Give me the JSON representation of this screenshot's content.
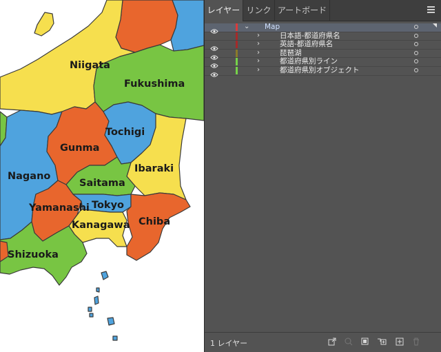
{
  "map": {
    "colors": {
      "yellow": "#f6df4e",
      "orange": "#e8662d",
      "green": "#78c543",
      "blue": "#4fa3de",
      "outline": "#3a3a3a"
    },
    "labels": {
      "niigata": "Niigata",
      "fukushima": "Fukushima",
      "tochigi": "Tochigi",
      "gunma": "Gunma",
      "ibaraki": "Ibaraki",
      "nagano": "Nagano",
      "saitama": "Saitama",
      "yamanashi": "Yamanashi",
      "tokyo": "Tokyo",
      "kanagawa": "Kanagawa",
      "chiba": "Chiba",
      "shizuoka": "Shizuoka"
    }
  },
  "panel": {
    "tabs": [
      "レイヤー",
      "リンク",
      "アートボード"
    ],
    "active_tab": "レイヤー",
    "menu_icon": "hamburger-menu-icon",
    "layers": [
      {
        "name": "Map",
        "visible": true,
        "expanded": true,
        "color": "#d93b3b",
        "level": 0,
        "selected": true
      },
      {
        "name": "日本語-都道府県名",
        "visible": false,
        "expanded": false,
        "color": "#a52a2a",
        "level": 1,
        "selected": false
      },
      {
        "name": "英語-都道府県名",
        "visible": true,
        "expanded": false,
        "color": "#a52a2a",
        "level": 1,
        "selected": false
      },
      {
        "name": "琵琶湖",
        "visible": true,
        "expanded": false,
        "color": "#8a7a2a",
        "level": 1,
        "selected": false
      },
      {
        "name": "都道府県別ライン",
        "visible": true,
        "expanded": false,
        "color": "#76d24a",
        "level": 1,
        "selected": false
      },
      {
        "name": "都道府県別オブジェクト",
        "visible": true,
        "expanded": false,
        "color": "#76d24a",
        "level": 1,
        "selected": false
      }
    ],
    "footer": {
      "layer_count": "1 レイヤー",
      "icons": [
        "export-icon",
        "search-icon",
        "clipping-mask-icon",
        "new-sublayer-icon",
        "new-layer-icon",
        "trash-icon"
      ]
    }
  }
}
